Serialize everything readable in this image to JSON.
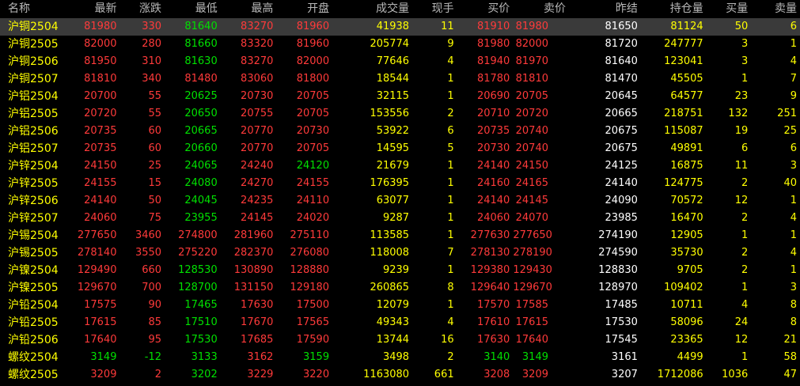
{
  "columns": [
    "名称",
    "最新",
    "涨跌",
    "最低",
    "最高",
    "开盘",
    "成交量",
    "现手",
    "买价",
    "卖价",
    "昨结",
    "持仓量",
    "买量",
    "卖量"
  ],
  "colors": {
    "up": "#ff3a3a",
    "down": "#00e000",
    "neutral": "#ffffff",
    "volume": "#ffff00"
  },
  "rows": [
    {
      "name": "沪铜2504",
      "last": "81980",
      "change": "330",
      "low": "81640",
      "high": "83270",
      "open": "81960",
      "volume": "41938",
      "current": "11",
      "bid": "81910",
      "ask": "81980",
      "settle": "81650",
      "oi": "81124",
      "bidvol": "50",
      "askvol": "6"
    },
    {
      "name": "沪铜2505",
      "last": "82000",
      "change": "280",
      "low": "81660",
      "high": "83320",
      "open": "81960",
      "volume": "205774",
      "current": "9",
      "bid": "81980",
      "ask": "82000",
      "settle": "81720",
      "oi": "247777",
      "bidvol": "3",
      "askvol": "1"
    },
    {
      "name": "沪铜2506",
      "last": "81950",
      "change": "310",
      "low": "81630",
      "high": "83270",
      "open": "82000",
      "volume": "77646",
      "current": "4",
      "bid": "81940",
      "ask": "81970",
      "settle": "81640",
      "oi": "123041",
      "bidvol": "3",
      "askvol": "4"
    },
    {
      "name": "沪铜2507",
      "last": "81810",
      "change": "340",
      "low": "81480",
      "high": "83060",
      "open": "81800",
      "volume": "18544",
      "current": "1",
      "bid": "81780",
      "ask": "81810",
      "settle": "81470",
      "oi": "45505",
      "bidvol": "1",
      "askvol": "7"
    },
    {
      "name": "沪铝2504",
      "last": "20700",
      "change": "55",
      "low": "20625",
      "high": "20730",
      "open": "20705",
      "volume": "32115",
      "current": "1",
      "bid": "20690",
      "ask": "20705",
      "settle": "20645",
      "oi": "64577",
      "bidvol": "23",
      "askvol": "9"
    },
    {
      "name": "沪铝2505",
      "last": "20720",
      "change": "55",
      "low": "20650",
      "high": "20755",
      "open": "20705",
      "volume": "153556",
      "current": "2",
      "bid": "20710",
      "ask": "20720",
      "settle": "20665",
      "oi": "218751",
      "bidvol": "132",
      "askvol": "251"
    },
    {
      "name": "沪铝2506",
      "last": "20735",
      "change": "60",
      "low": "20665",
      "high": "20770",
      "open": "20730",
      "volume": "53922",
      "current": "6",
      "bid": "20735",
      "ask": "20740",
      "settle": "20675",
      "oi": "115087",
      "bidvol": "19",
      "askvol": "25"
    },
    {
      "name": "沪铝2507",
      "last": "20735",
      "change": "60",
      "low": "20660",
      "high": "20770",
      "open": "20705",
      "volume": "14595",
      "current": "5",
      "bid": "20730",
      "ask": "20740",
      "settle": "20675",
      "oi": "49891",
      "bidvol": "6",
      "askvol": "6"
    },
    {
      "name": "沪锌2504",
      "last": "24150",
      "change": "25",
      "low": "24065",
      "high": "24240",
      "open": "24120",
      "volume": "21679",
      "current": "1",
      "bid": "24140",
      "ask": "24150",
      "settle": "24125",
      "oi": "16875",
      "bidvol": "11",
      "askvol": "3"
    },
    {
      "name": "沪锌2505",
      "last": "24155",
      "change": "15",
      "low": "24080",
      "high": "24270",
      "open": "24155",
      "volume": "176395",
      "current": "1",
      "bid": "24160",
      "ask": "24165",
      "settle": "24140",
      "oi": "124775",
      "bidvol": "2",
      "askvol": "40"
    },
    {
      "name": "沪锌2506",
      "last": "24140",
      "change": "50",
      "low": "24045",
      "high": "24235",
      "open": "24110",
      "volume": "63077",
      "current": "1",
      "bid": "24140",
      "ask": "24145",
      "settle": "24090",
      "oi": "70572",
      "bidvol": "12",
      "askvol": "1"
    },
    {
      "name": "沪锌2507",
      "last": "24060",
      "change": "75",
      "low": "23955",
      "high": "24145",
      "open": "24020",
      "volume": "9287",
      "current": "1",
      "bid": "24060",
      "ask": "24070",
      "settle": "23985",
      "oi": "16470",
      "bidvol": "2",
      "askvol": "4"
    },
    {
      "name": "沪锡2504",
      "last": "277650",
      "change": "3460",
      "low": "274800",
      "high": "281960",
      "open": "275110",
      "volume": "113585",
      "current": "1",
      "bid": "277630",
      "ask": "277650",
      "settle": "274190",
      "oi": "12905",
      "bidvol": "1",
      "askvol": "1"
    },
    {
      "name": "沪锡2505",
      "last": "278140",
      "change": "3550",
      "low": "275220",
      "high": "282370",
      "open": "276080",
      "volume": "118008",
      "current": "7",
      "bid": "278130",
      "ask": "278190",
      "settle": "274590",
      "oi": "35730",
      "bidvol": "2",
      "askvol": "4"
    },
    {
      "name": "沪镍2504",
      "last": "129490",
      "change": "660",
      "low": "128530",
      "high": "130890",
      "open": "128880",
      "volume": "9239",
      "current": "1",
      "bid": "129380",
      "ask": "129430",
      "settle": "128830",
      "oi": "9705",
      "bidvol": "2",
      "askvol": "1"
    },
    {
      "name": "沪镍2505",
      "last": "129670",
      "change": "700",
      "low": "128700",
      "high": "131150",
      "open": "129180",
      "volume": "260865",
      "current": "8",
      "bid": "129640",
      "ask": "129670",
      "settle": "128970",
      "oi": "109402",
      "bidvol": "1",
      "askvol": "3"
    },
    {
      "name": "沪铅2504",
      "last": "17575",
      "change": "90",
      "low": "17465",
      "high": "17630",
      "open": "17500",
      "volume": "12079",
      "current": "1",
      "bid": "17570",
      "ask": "17585",
      "settle": "17485",
      "oi": "10711",
      "bidvol": "4",
      "askvol": "8"
    },
    {
      "name": "沪铅2505",
      "last": "17615",
      "change": "85",
      "low": "17510",
      "high": "17670",
      "open": "17565",
      "volume": "49343",
      "current": "4",
      "bid": "17610",
      "ask": "17615",
      "settle": "17530",
      "oi": "58096",
      "bidvol": "24",
      "askvol": "8"
    },
    {
      "name": "沪铅2506",
      "last": "17640",
      "change": "95",
      "low": "17530",
      "high": "17685",
      "open": "17590",
      "volume": "13744",
      "current": "16",
      "bid": "17630",
      "ask": "17640",
      "settle": "17545",
      "oi": "23365",
      "bidvol": "12",
      "askvol": "21"
    },
    {
      "name": "螺纹2504",
      "last": "3149",
      "change": "-12",
      "low": "3133",
      "high": "3162",
      "open": "3159",
      "volume": "3498",
      "current": "2",
      "bid": "3140",
      "ask": "3149",
      "settle": "3161",
      "oi": "4499",
      "bidvol": "1",
      "askvol": "58"
    },
    {
      "name": "螺纹2505",
      "last": "3209",
      "change": "2",
      "low": "3202",
      "high": "3229",
      "open": "3220",
      "volume": "1163080",
      "current": "661",
      "bid": "3208",
      "ask": "3209",
      "settle": "3207",
      "oi": "1712086",
      "bidvol": "1036",
      "askvol": "47"
    }
  ]
}
